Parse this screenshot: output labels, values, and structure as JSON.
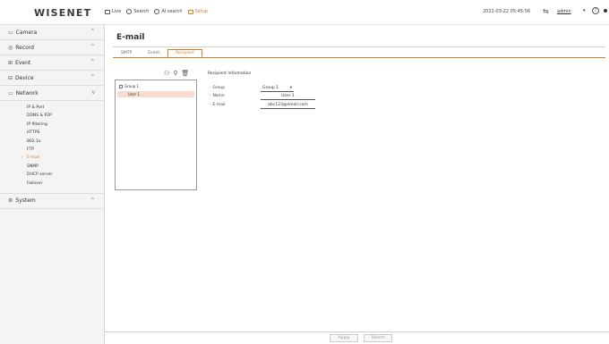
{
  "app": {
    "logo": "WISENET"
  },
  "topnav": [
    {
      "label": "Live",
      "icon": "monitor-icon",
      "active": false
    },
    {
      "label": "Search",
      "icon": "search-icon",
      "active": false
    },
    {
      "label": "AI search",
      "icon": "ai-search-icon",
      "active": false
    },
    {
      "label": "Setup",
      "icon": "setup-icon",
      "active": true
    }
  ],
  "status": {
    "datetime": "2022-03-22 05:45:56",
    "user": "admin",
    "help": "?"
  },
  "sidebar": {
    "menus": [
      {
        "label": "Camera",
        "icon": "camera-icon",
        "caret": "^"
      },
      {
        "label": "Record",
        "icon": "record-icon",
        "caret": "^"
      },
      {
        "label": "Event",
        "icon": "event-icon",
        "caret": "^"
      },
      {
        "label": "Device",
        "icon": "device-icon",
        "caret": "^"
      },
      {
        "label": "Network",
        "icon": "network-icon",
        "caret": "v"
      },
      {
        "label": "System",
        "icon": "system-icon",
        "caret": "^"
      }
    ],
    "network_items": [
      "IP & Port",
      "DDNS & P2P",
      "IP filtering",
      "HTTPS",
      "802.1x",
      "FTP",
      "E-mail",
      "SNMP",
      "DHCP server",
      "Failover"
    ],
    "active_item": "E-mail"
  },
  "page": {
    "title": "E-mail",
    "tabs": [
      {
        "label": "SMTP",
        "active": false
      },
      {
        "label": "Event",
        "active": false
      },
      {
        "label": "Recipient",
        "active": true
      }
    ]
  },
  "tree": {
    "group": "Group 1",
    "user": "User 1"
  },
  "recipient": {
    "section_title": "Recipient Information",
    "group_label": "Group",
    "group_value": "Group 1",
    "name_label": "Name",
    "name_value": "User 1",
    "email_label": "E-mail",
    "email_value": "abc123@email.com"
  },
  "buttons": {
    "apply": "Apply",
    "revert": "Revert"
  },
  "colors": {
    "accent": "#e07b2e",
    "selection": "#f6ddd0"
  }
}
